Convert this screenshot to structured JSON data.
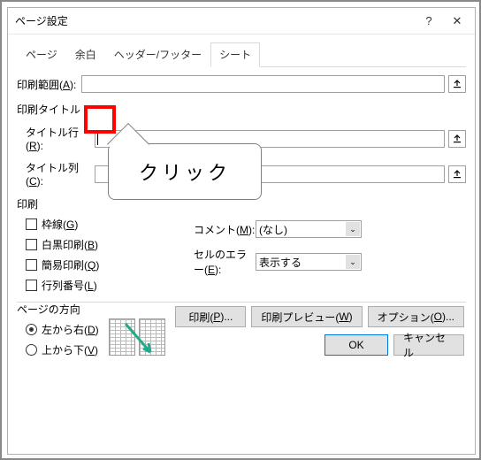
{
  "window": {
    "title": "ページ設定",
    "help": "?",
    "close": "✕"
  },
  "tabs": {
    "page": "ページ",
    "margin": "余白",
    "hf": "ヘッダー/フッター",
    "sheet": "シート"
  },
  "printArea": {
    "label": "印刷範囲(",
    "key": "A",
    "suffix": "):",
    "value": ""
  },
  "printTitles": {
    "section": "印刷タイトル",
    "rows": {
      "label": "タイトル行(",
      "key": "R",
      "suffix": "):",
      "value": ""
    },
    "cols": {
      "label": "タイトル列(",
      "key": "C",
      "suffix": "):",
      "value": ""
    }
  },
  "print": {
    "section": "印刷",
    "gridlines": {
      "label": "枠線(",
      "key": "G",
      "suffix": ")"
    },
    "bw": {
      "label": "白黒印刷(",
      "key": "B",
      "suffix": ")"
    },
    "draft": {
      "label": "簡易印刷(",
      "key": "Q",
      "suffix": ")"
    },
    "rowcol": {
      "label": "行列番号(",
      "key": "L",
      "suffix": ")"
    },
    "comments": {
      "label": "コメント(",
      "key": "M",
      "suffix": "):",
      "value": "(なし)"
    },
    "errors": {
      "label": "セルのエラー(",
      "key": "E",
      "suffix": "):",
      "value": "表示する"
    }
  },
  "order": {
    "section": "ページの方向",
    "ltr": {
      "label": "左から右(",
      "key": "D",
      "suffix": ")"
    },
    "ttb": {
      "label": "上から下(",
      "key": "V",
      "suffix": ")"
    }
  },
  "buttons": {
    "print": {
      "label": "印刷(",
      "key": "P",
      "suffix": ")..."
    },
    "preview": {
      "label": "印刷プレビュー(",
      "key": "W",
      "suffix": ")"
    },
    "options": {
      "label": "オプション(",
      "key": "O",
      "suffix": ")..."
    },
    "ok": "OK",
    "cancel": "キャンセル"
  },
  "callout": {
    "text": "クリック"
  }
}
